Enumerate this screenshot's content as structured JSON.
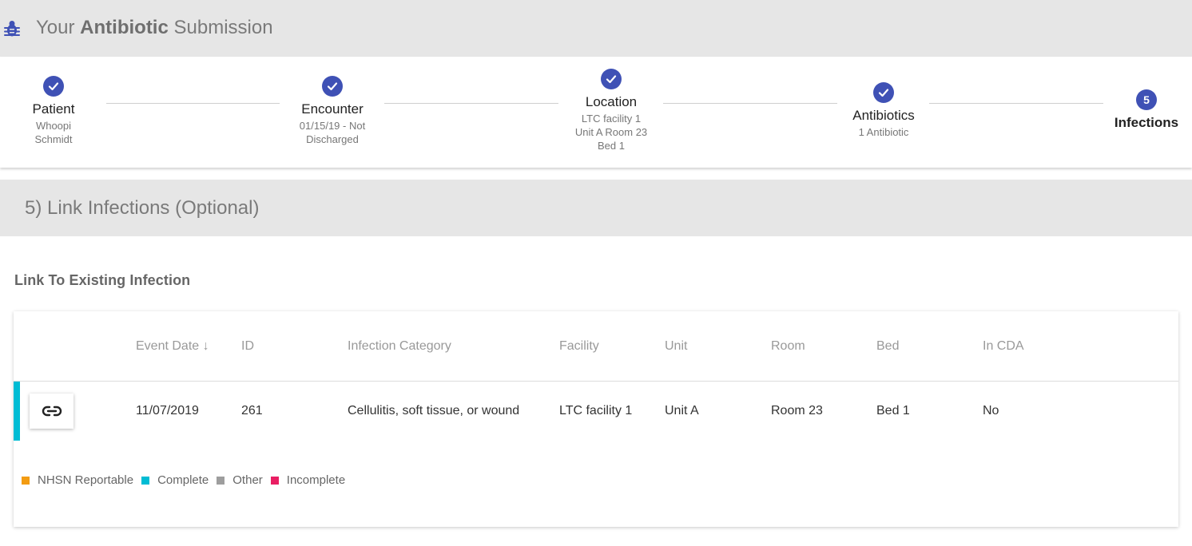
{
  "header": {
    "title_prefix": "Your",
    "title_bold": "Antibiotic",
    "title_suffix": "Submission",
    "icon": "bug-icon"
  },
  "stepper": {
    "steps": [
      {
        "label": "Patient",
        "sub": [
          "Whoopi",
          "Schmidt"
        ],
        "state": "complete"
      },
      {
        "label": "Encounter",
        "sub": [
          "01/15/19 - Not",
          "Discharged"
        ],
        "state": "complete"
      },
      {
        "label": "Location",
        "sub": [
          "LTC facility 1",
          "Unit A Room 23",
          "Bed 1"
        ],
        "state": "complete"
      },
      {
        "label": "Antibiotics",
        "sub": [
          "1 Antibiotic"
        ],
        "state": "complete"
      },
      {
        "label": "Infections",
        "number": "5",
        "state": "active"
      }
    ]
  },
  "section": {
    "title": "5) Link Infections (Optional)",
    "subheading": "Link To Existing Infection"
  },
  "table": {
    "columns": [
      "Event Date ↓",
      "ID",
      "Infection Category",
      "Facility",
      "Unit",
      "Room",
      "Bed",
      "In CDA"
    ],
    "rows": [
      {
        "status": "Complete",
        "event_date": "11/07/2019",
        "id": "261",
        "category": "Cellulitis, soft tissue, or wound",
        "facility": "LTC facility 1",
        "unit": "Unit A",
        "room": "Room 23",
        "bed": "Bed 1",
        "in_cda": "No"
      }
    ]
  },
  "legend": [
    {
      "label": "NHSN Reportable",
      "color": "#f39c12"
    },
    {
      "label": "Complete",
      "color": "#00bcd4"
    },
    {
      "label": "Other",
      "color": "#9e9e9e"
    },
    {
      "label": "Incomplete",
      "color": "#e91e63"
    }
  ],
  "colors": {
    "accent": "#3f51b5",
    "complete": "#00bcd4"
  }
}
